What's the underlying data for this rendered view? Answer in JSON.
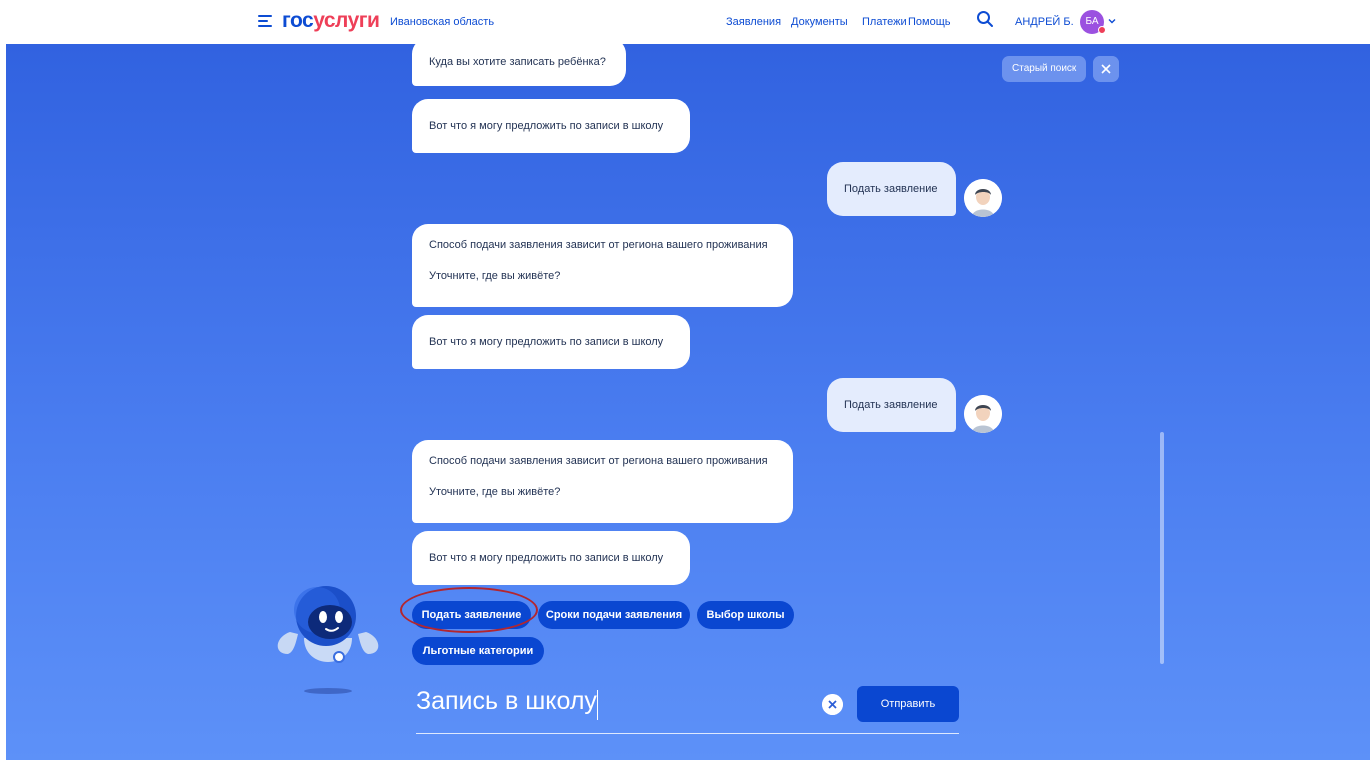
{
  "header": {
    "logo_part1": "гос",
    "logo_part2": "услуги",
    "region": "Ивановская область",
    "nav": [
      "Заявления",
      "Документы",
      "Платежи",
      "Помощь"
    ],
    "username": "АНДРЕЙ Б.",
    "avatar_initials": "БА",
    "icons": {
      "menu": "hamburger-icon",
      "search": "search-icon",
      "dropdown": "chevron-down-icon"
    }
  },
  "top_actions": {
    "old_search": "Старый поиск",
    "close_icon": "close-icon"
  },
  "chat": {
    "messages": [
      {
        "from": "bot",
        "lines": [
          "Куда вы хотите записать ребёнка?"
        ]
      },
      {
        "from": "bot",
        "lines": [
          "Вот что я могу предложить по записи в школу"
        ]
      },
      {
        "from": "user",
        "lines": [
          "Подать заявление"
        ]
      },
      {
        "from": "bot",
        "lines": [
          "Способ подачи заявления зависит от региона вашего проживания",
          "Уточните, где вы живёте?"
        ]
      },
      {
        "from": "bot",
        "lines": [
          "Вот что я могу предложить по записи в школу"
        ]
      },
      {
        "from": "user",
        "lines": [
          "Подать заявление"
        ]
      },
      {
        "from": "bot",
        "lines": [
          "Способ подачи заявления зависит от региона вашего проживания",
          "Уточните, где вы живёте?"
        ]
      },
      {
        "from": "bot",
        "lines": [
          "Вот что я могу предложить по записи в школу"
        ]
      }
    ],
    "quick_replies": [
      "Подать заявление",
      "Сроки подачи заявления",
      "Выбор школы",
      "Льготные категории"
    ]
  },
  "input": {
    "value": "Запись в школу",
    "send_label": "Отправить",
    "clear_icon": "clear-icon"
  },
  "colors": {
    "brand_blue": "#0d4cd3",
    "brand_red": "#ee3f58",
    "chip_blue": "#0a47d1",
    "avatar_purple": "#9b51e0",
    "highlight_circle": "#b3262f"
  }
}
